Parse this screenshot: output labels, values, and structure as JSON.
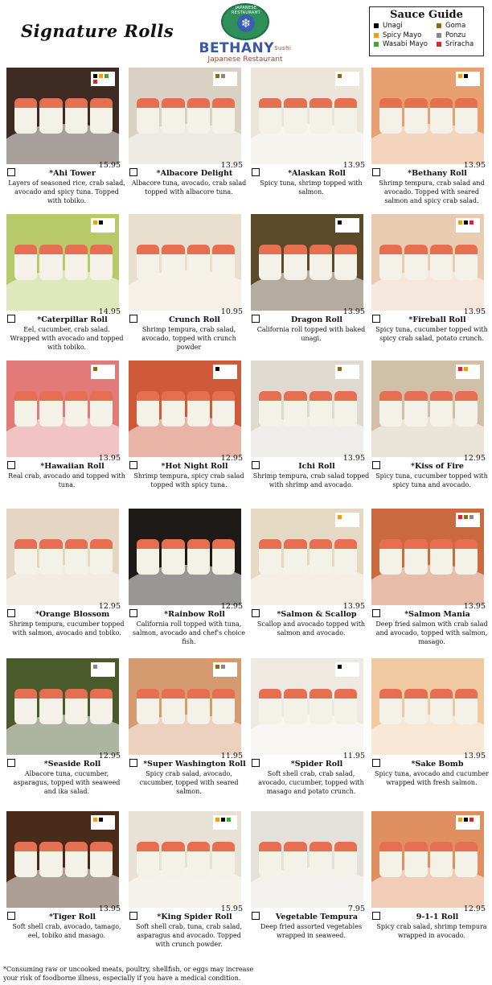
{
  "page_title": "Signature Rolls",
  "logo": {
    "ring_text": "JAPANESE RESTAURANT",
    "name": "BETHANY",
    "name_suffix": "Sushi",
    "subtitle": "Japanese Restaurant",
    "brand_green": "#2f8f5b",
    "brand_blue": "#3a56a8"
  },
  "sauce_guide": {
    "title": "Sauce Guide",
    "items": [
      {
        "label": "Unagi",
        "color": "#000000"
      },
      {
        "label": "Goma",
        "color": "#8b6a14"
      },
      {
        "label": "Spicy Mayo",
        "color": "#f39c12"
      },
      {
        "label": "Ponzu",
        "color": "#888888"
      },
      {
        "label": "Wasabi Mayo",
        "color": "#3aaa35"
      },
      {
        "label": "Sriracha",
        "color": "#d62828"
      }
    ]
  },
  "items": [
    {
      "name": "*Ahi Tower",
      "price": "15.95",
      "desc": "Layers of seasoned rice, crab salad, avocado and spicy tuna. Topped with tobiko.",
      "sauces": [
        "#000000",
        "#f39c12",
        "#3aaa35",
        "#d62828"
      ],
      "photo": "#3d2b22"
    },
    {
      "name": "*Albacore Delight",
      "price": "13.95",
      "desc": "Albacore tuna, avocado, crab salad topped with albacore tuna.",
      "sauces": [
        "#8b6a14",
        "#888888"
      ],
      "photo": "#d9d2c4"
    },
    {
      "name": "*Alaskan Roll",
      "price": "13.95",
      "desc": "Spicy tuna, shrimp topped with salmon.",
      "sauces": [
        "#8b6a14"
      ],
      "photo": "#ece6da"
    },
    {
      "name": "*Bethany Roll",
      "price": "13.95",
      "desc": "Shrimp tempura, crab salad and avocado. Topped with seared salmon and spicy crab salad.",
      "sauces": [
        "#f39c12",
        "#000000"
      ],
      "photo": "#e9a070"
    },
    {
      "name": "*Caterpillar Roll",
      "price": "14.95",
      "desc": "Eel, cucumber, crab salad. Wrapped with avocado and topped with tobiko.",
      "sauces": [
        "#f39c12",
        "#000000"
      ],
      "photo": "#b8c96a"
    },
    {
      "name": "Crunch Roll",
      "price": "10.95",
      "desc": "Shrimp tempura, crab salad, avocado, topped with crunch powder",
      "sauces": [],
      "photo": "#e8dfcf"
    },
    {
      "name": "Dragon Roll",
      "price": "13.95",
      "desc": "California roll topped with baked unagi.",
      "sauces": [
        "#000000"
      ],
      "photo": "#5a4a2a"
    },
    {
      "name": "*Fireball Roll",
      "price": "13.95",
      "desc": "Spicy tuna, cucumber topped with spicy crab salad, potato crunch.",
      "sauces": [
        "#f39c12",
        "#000000",
        "#d62828"
      ],
      "photo": "#e8cbb0"
    },
    {
      "name": "*Hawaiian Roll",
      "price": "13.95",
      "desc": "Real crab, avocado and topped with tuna.",
      "sauces": [
        "#8b6a14"
      ],
      "photo": "#e27a7a"
    },
    {
      "name": "*Hot Night Roll",
      "price": "12.95",
      "desc": "Shrimp tempura, spicy crab salad topped with spicy tuna.",
      "sauces": [
        "#000000"
      ],
      "photo": "#cf5a3a"
    },
    {
      "name": "Ichi Roll",
      "price": "13.95",
      "desc": "Shrimp tempura, crab salad topped with shrimp and avocado.",
      "sauces": [
        "#8b6a14"
      ],
      "photo": "#dedad0"
    },
    {
      "name": "*Kiss of Fire",
      "price": "12.95",
      "desc": "Spicy tuna, cucumber topped with spicy tuna and avocado.",
      "sauces": [
        "#d62828",
        "#f39c12"
      ],
      "photo": "#d0c0a8"
    },
    {
      "name": "*Orange Blossom",
      "price": "12.95",
      "desc": "Shrimp tempura, cucumber topped with salmon, avocado and tobiko.",
      "sauces": [],
      "photo": "#e4d6c2"
    },
    {
      "name": "*Rainbow Roll",
      "price": "12.95",
      "desc": "California roll topped with tuna, salmon, avocado and chef's choice fish.",
      "sauces": [],
      "photo": "#1e1a18"
    },
    {
      "name": "*Salmon & Scallop",
      "price": "13.95",
      "desc": "Scallop and avocado topped with salmon and avocado.",
      "sauces": [
        "#f39c12"
      ],
      "photo": "#e6d9c4"
    },
    {
      "name": "*Salmon Mania",
      "price": "13.95",
      "desc": "Deep fried salmon with crab salad and avocado, topped with salmon, masago.",
      "sauces": [
        "#d62828",
        "#8b6a14",
        "#888888"
      ],
      "photo": "#c96a3f"
    },
    {
      "name": "*Seaside Roll",
      "price": "12.95",
      "desc": "Albacore tuna, cucumber, asparagus, topped with seaweed and ika salad.",
      "sauces": [
        "#888888"
      ],
      "photo": "#4a5a2a"
    },
    {
      "name": "*Super Washington Roll",
      "price": "11.95",
      "desc": "Spicy crab salad, avocado, cucumber, topped with seared salmon.",
      "sauces": [
        "#8b6a14",
        "#888888"
      ],
      "photo": "#d49a70"
    },
    {
      "name": "*Spider Roll",
      "price": "11.95",
      "desc": "Soft shell crab, crab salad, avocado, cucumber, topped with masago and potato crunch.",
      "sauces": [
        "#000000"
      ],
      "photo": "#eeeae2"
    },
    {
      "name": "*Sake Bomb",
      "price": "13.95",
      "desc": "Spicy tuna, avocado and cucumber wrapped with fresh salmon.",
      "sauces": [],
      "photo": "#f0c9a0"
    },
    {
      "name": "*Tiger Roll",
      "price": "13.95",
      "desc": "Soft shell crab, avocado, tamago, eel, tobiko and masago.",
      "sauces": [
        "#f39c12",
        "#000000"
      ],
      "photo": "#4a2a18"
    },
    {
      "name": "*King Spider Roll",
      "price": "15.95",
      "desc": "Soft shell crab, tuna, crab salad, asparagus and avocado. Topped with crunch powder.",
      "sauces": [
        "#f39c12",
        "#000000",
        "#3aaa35"
      ],
      "photo": "#e8e2d6"
    },
    {
      "name": "Vegetable Tempura",
      "price": "7.95",
      "desc": "Deep fried assorted vegetables wrapped in seaweed.",
      "sauces": [],
      "photo": "#e4e0da"
    },
    {
      "name": "9-1-1 Roll",
      "price": "12.95",
      "desc": "Spicy crab salad, shrimp tempura wrapped in avocado.",
      "sauces": [
        "#f39c12",
        "#000000",
        "#d62828"
      ],
      "photo": "#e09060"
    }
  ],
  "footnote": "*Consuming raw or uncooked meats, poultry, shellfish, or eggs may increase your risk of foodborne illness, especially if you have a medical condition."
}
